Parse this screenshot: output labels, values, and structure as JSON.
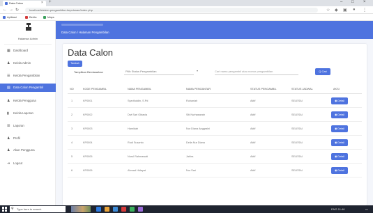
{
  "browser": {
    "tab_title": "Data Calon",
    "tab_close": "×",
    "new_tab": "+",
    "url": "localhost/sistem-pengambilan-keputusan/index.php",
    "bookmarks": [
      "Aplikasi",
      "Berita",
      "Maps"
    ],
    "window_controls": [
      "–",
      "□",
      "×"
    ]
  },
  "sidebar": {
    "app_name": "Halaman Admin",
    "items": [
      {
        "icon": "dashboard-icon",
        "glyph": "▦",
        "label": "Dashboard"
      },
      {
        "icon": "user-icon",
        "glyph": "♟",
        "label": "Kelola Admin"
      },
      {
        "icon": "list-icon",
        "glyph": "☰",
        "label": "Kelola Pengambilan"
      },
      {
        "icon": "table-icon",
        "glyph": "▤",
        "label": "Data Calon Pengambil",
        "active": true
      },
      {
        "icon": "user-icon",
        "glyph": "♟",
        "label": "Kelola Pengguna"
      },
      {
        "icon": "chart-icon",
        "glyph": "▮",
        "label": "Kelola Laporan"
      },
      {
        "icon": "report-icon",
        "glyph": "☰",
        "label": "Laporan"
      },
      {
        "icon": "profile-icon",
        "glyph": "♟",
        "label": "Profil"
      },
      {
        "icon": "account-icon",
        "glyph": "♟",
        "label": "Akun Pengguna"
      },
      {
        "icon": "logout-icon",
        "glyph": "⇥",
        "label": "Logout"
      }
    ]
  },
  "topbar": {
    "breadcrumb": "Data Calon / Halaman Pengambilan"
  },
  "main": {
    "title": "Data Calon",
    "add_button": "Tambah",
    "filter_label": "Tampilkan Berdasarkan",
    "filter_value": "Pilih Status Pengambilan",
    "search_placeholder": "Cari nama pengambil atau nomor pengambilan",
    "search_button": "Q Cari",
    "table": {
      "headers": [
        "NO",
        "KODE PENGAMBIL",
        "NAMA PENGAMBIL",
        "NAMA PENGANTAR",
        "STATUS PENGAMBIL",
        "STATUS JADWAL",
        "AKSI"
      ],
      "rows": [
        [
          "1",
          "KP0001",
          "Syarifuddin, S.Pd",
          "Ruhaniah",
          "Aktif",
          "SELESAI",
          "◉ Detail"
        ],
        [
          "2",
          "KP0002",
          "Dwi Sari Oktavia",
          "Siti Nurhasanah",
          "Aktif",
          "SELESAI",
          "◉ Detail"
        ],
        [
          "3",
          "KP0003",
          "Hamidah",
          "Nur Diana Anggraini",
          "Aktif",
          "SELESAI",
          "◉ Detail"
        ],
        [
          "4",
          "KP0004",
          "Rudi Susanto",
          "Della Nur Diana",
          "Aktif",
          "SELESAI",
          "◉ Detail"
        ],
        [
          "5",
          "KP0005",
          "Nurul Rahmawati",
          "Jahira",
          "Aktif",
          "SELESAI",
          "◉ Detail"
        ],
        [
          "6",
          "KP0006",
          "Ahmad Hidayat",
          "Nur Sari",
          "Aktif",
          "SELESAI",
          "◉ Detail"
        ]
      ]
    }
  },
  "taskbar": {
    "search_text": "Type here to search",
    "tray_text": "ENG  11:46",
    "icon_colors": [
      "#2d7be0",
      "#e8a33a",
      "#3d8bd6",
      "#d63a3a",
      "#3ab05c",
      "#9a6ad8"
    ]
  }
}
